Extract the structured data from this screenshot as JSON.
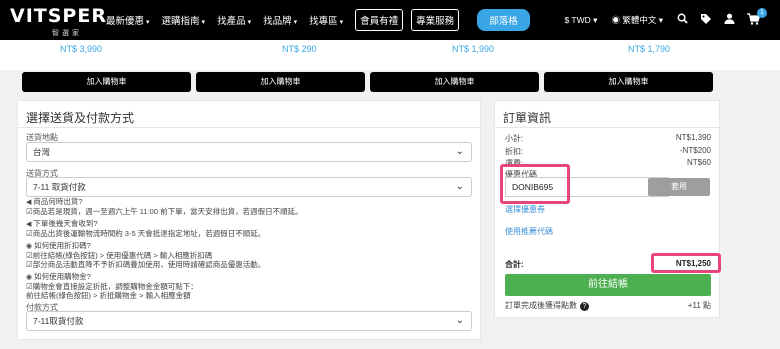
{
  "header": {
    "logo_text": "VITSPER",
    "logo_sub": "智選家",
    "nav": [
      "最新優惠",
      "選購指南",
      "找產品",
      "找品牌",
      "找專區"
    ],
    "member_gift": "會員有禮",
    "pro_service": "專業服務",
    "blog": "部落格",
    "currency": "$ TWD",
    "language": "繁體中文",
    "cart_count": "1"
  },
  "product_strip": {
    "prices": [
      "NT$ 3,990",
      "NT$ 290",
      "NT$ 1,990",
      "NT$ 1,790"
    ],
    "add_to_cart": "加入購物車"
  },
  "shipping": {
    "title": "選擇送貨及付款方式",
    "location_label": "送貨地點",
    "location_value": "台灣",
    "method_label": "送貨方式",
    "method_value": "7-11 取貨付款",
    "note1_title": "商品何時出貨?",
    "note1_body": "☑商品若是現貨，週一至週六上午 11:00 前下單，當天安排出貨，若週假日不順延。",
    "note2_title": "下單後幾天會收到?",
    "note2_body": "☑商品出貨後運輸物流時間約 3-5 天會抵達指定地址，若週假日不順延。",
    "note3_title": "如何使用折扣碼?",
    "note3_line1": "☑前往結帳(綠色按鈕) > 使用優惠代碼 > 輸入相應折扣碼",
    "note3_line2": "☑部分商品活動直降不予折扣碼疊加使用，使用時請確認商品優惠活動。",
    "note4_title": "如何使用購物金?",
    "note4_line1": "☑購物金會直接設定折抵，調整購物金金額可點下：",
    "note4_line2": "前往結帳(綠色按鈕) > 折抵購物金 > 輸入相應金額",
    "payment_label": "付款方式",
    "payment_value": "7-11取貨付款"
  },
  "order": {
    "title": "訂單資訊",
    "subtotal_label": "小計:",
    "subtotal_value": "NT$1,390",
    "discount_label": "折扣:",
    "discount_value": "-NT$200",
    "shipping_label": "運費:",
    "shipping_value": "NT$60",
    "coupon_label": "優惠代碼",
    "coupon_value": "DONIB695",
    "apply_label": "套用",
    "choose_coupon": "選擇優惠券",
    "use_referral": "使用推薦代碼",
    "total_label": "合計:",
    "total_value": "NT$1,250",
    "checkout_label": "前往結帳",
    "points_label": "訂單完成後獲得點數",
    "points_value": "+11 點"
  },
  "colors": {
    "accent": "#3aa6e6",
    "checkout": "#4caf50",
    "highlight": "#e8457a"
  }
}
